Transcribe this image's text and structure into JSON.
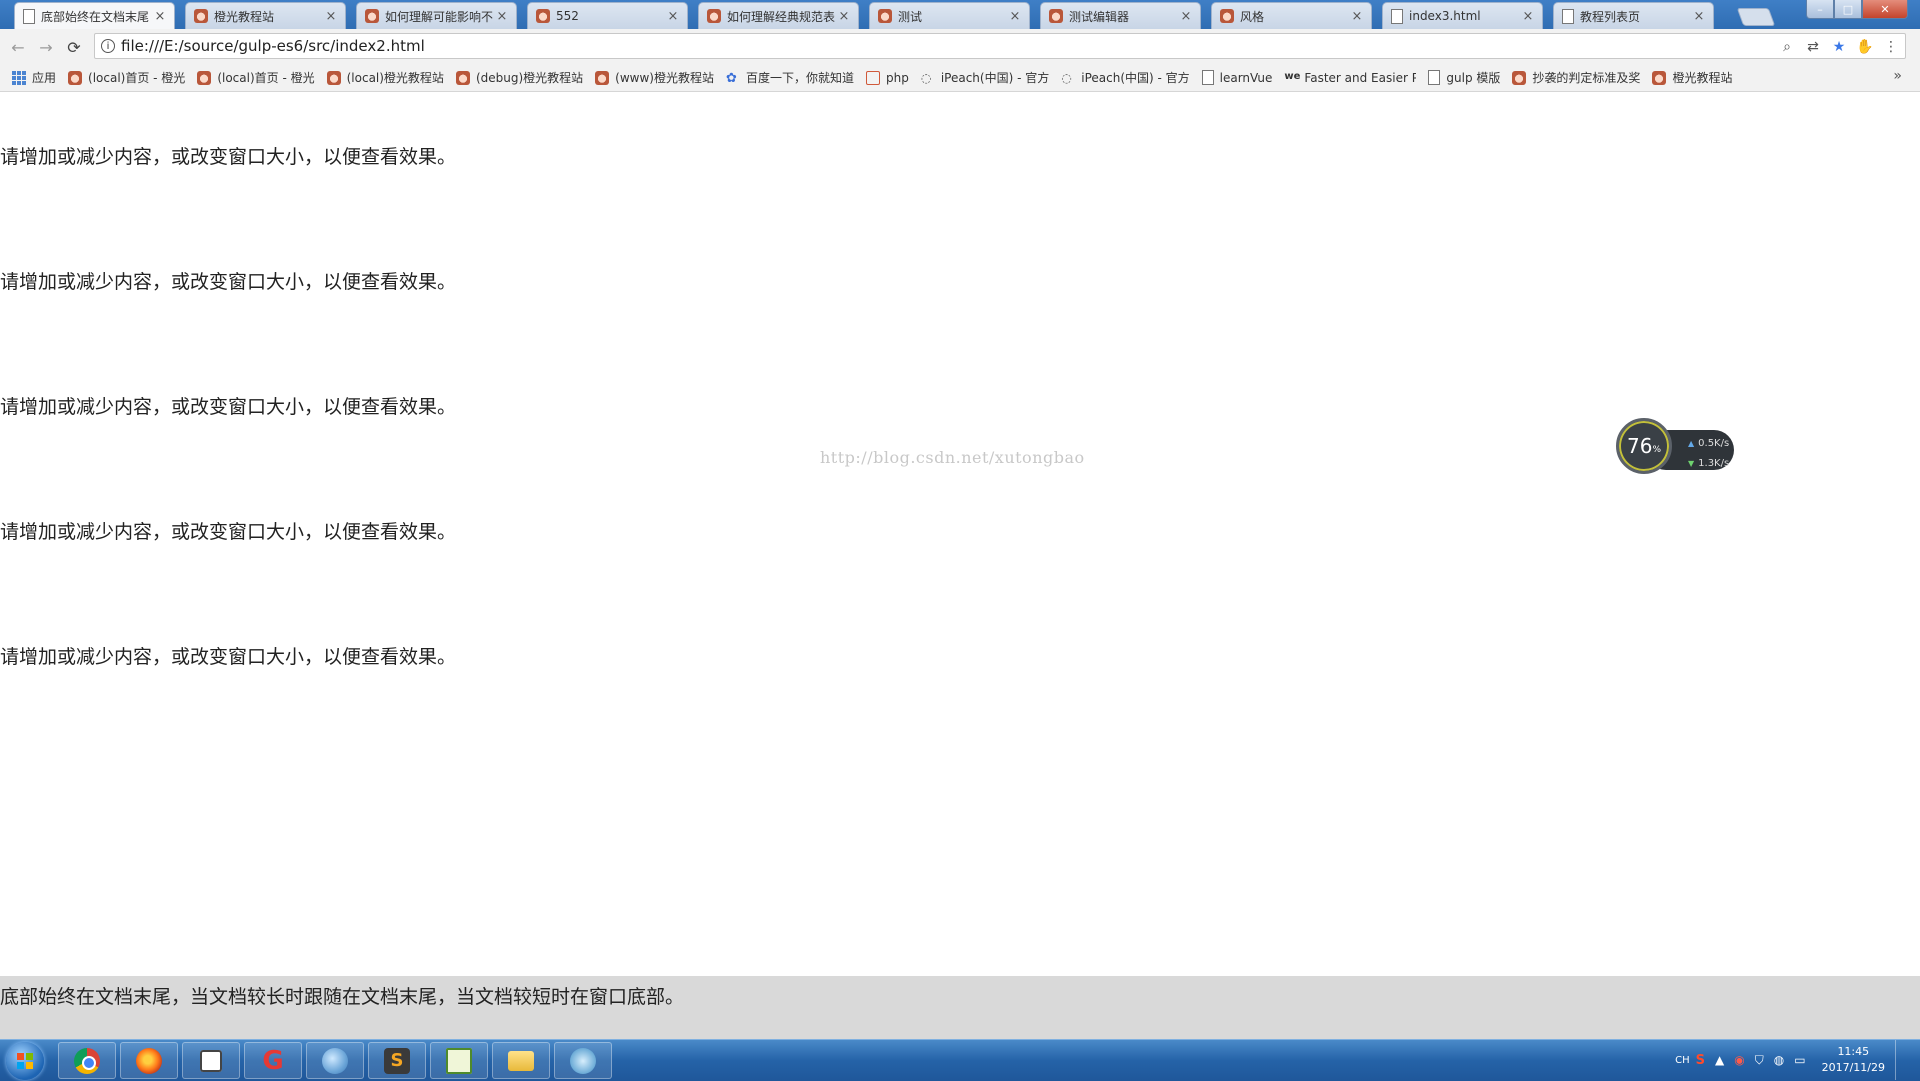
{
  "browser": {
    "tabs": [
      {
        "title": "底部始终在文档末尾",
        "active": true,
        "icon": "document-icon"
      },
      {
        "title": "橙光教程站",
        "icon": "anime-face-icon"
      },
      {
        "title": "如何理解可能影响不",
        "icon": "anime-face-icon"
      },
      {
        "title": "552",
        "icon": "anime-face-icon"
      },
      {
        "title": "如何理解经典规范表",
        "icon": "anime-face-icon"
      },
      {
        "title": "测试",
        "icon": "anime-face-icon"
      },
      {
        "title": "测试编辑器",
        "icon": "anime-face-icon"
      },
      {
        "title": "风格",
        "icon": "anime-face-icon"
      },
      {
        "title": "index3.html",
        "icon": "document-icon"
      },
      {
        "title": "教程列表页",
        "icon": "document-icon"
      }
    ],
    "tab_close_glyph": "×",
    "url": "file:///E:/source/gulp-es6/src/index2.html",
    "nav": {
      "back": "←",
      "forward": "→",
      "reload": "⟳"
    },
    "omnibox_icons": {
      "zoom": "⌕",
      "translate": "⇄",
      "star": "★",
      "extension": "✋",
      "menu": "⋮"
    },
    "window_controls": {
      "minimize": "–",
      "maximize": "□",
      "close": "✕"
    }
  },
  "bookmarks": {
    "items": [
      {
        "label": "应用",
        "icon": "apps-grid-icon"
      },
      {
        "label": "(local)首页 - 橙光",
        "icon": "anime-face-icon"
      },
      {
        "label": "(local)首页 - 橙光",
        "icon": "anime-face-icon"
      },
      {
        "label": "(local)橙光教程站",
        "icon": "anime-face-icon"
      },
      {
        "label": "(debug)橙光教程站",
        "icon": "anime-face-icon"
      },
      {
        "label": "(www)橙光教程站",
        "icon": "anime-face-icon"
      },
      {
        "label": "百度一下，你就知道",
        "icon": "baidu-paw-icon"
      },
      {
        "label": "php",
        "icon": "php-icon"
      },
      {
        "label": "iPeach(中国) - 官方",
        "icon": "qq-icon"
      },
      {
        "label": "iPeach(中国) - 官方",
        "icon": "qq-icon"
      },
      {
        "label": "learnVue",
        "icon": "document-icon"
      },
      {
        "label": "Faster and Easier P",
        "icon": "we-icon"
      },
      {
        "label": "gulp 模版",
        "icon": "document-icon"
      },
      {
        "label": "抄袭的判定标准及奖",
        "icon": "anime-face-icon"
      },
      {
        "label": "橙光教程站",
        "icon": "anime-face-icon"
      }
    ],
    "more": "»"
  },
  "page": {
    "paragraphs": [
      "请增加或减少内容，或改变窗口大小，以便查看效果。",
      "请增加或减少内容，或改变窗口大小，以便查看效果。",
      "请增加或减少内容，或改变窗口大小，以便查看效果。",
      "请增加或减少内容，或改变窗口大小，以便查看效果。",
      "请增加或减少内容，或改变窗口大小，以便查看效果。"
    ],
    "watermark": "http://blog.csdn.net/xutongbao",
    "footer": "底部始终在文档末尾，当文档较长时跟随在文档末尾，当文档较短时在窗口底部。"
  },
  "speed_widget": {
    "percent": "76",
    "percent_sign": "%",
    "upload": "0.5K/s",
    "download": "1.3K/s",
    "up_arrow": "▲",
    "down_arrow": "▼"
  },
  "taskbar": {
    "apps": [
      "chrome",
      "firefox",
      "virtualbox",
      "redapp",
      "browser-globe",
      "sublime",
      "chart-app",
      "file-explorer",
      "network-app"
    ],
    "tray": {
      "lang": "CH",
      "time": "11:45",
      "date": "2017/11/29",
      "show_hidden": "▲"
    }
  },
  "colors": {
    "footer_bg": "#d9d9d9",
    "tabstrip": "#3f7fc6",
    "taskbar": "#2563a8",
    "star": "#3b78e7"
  }
}
